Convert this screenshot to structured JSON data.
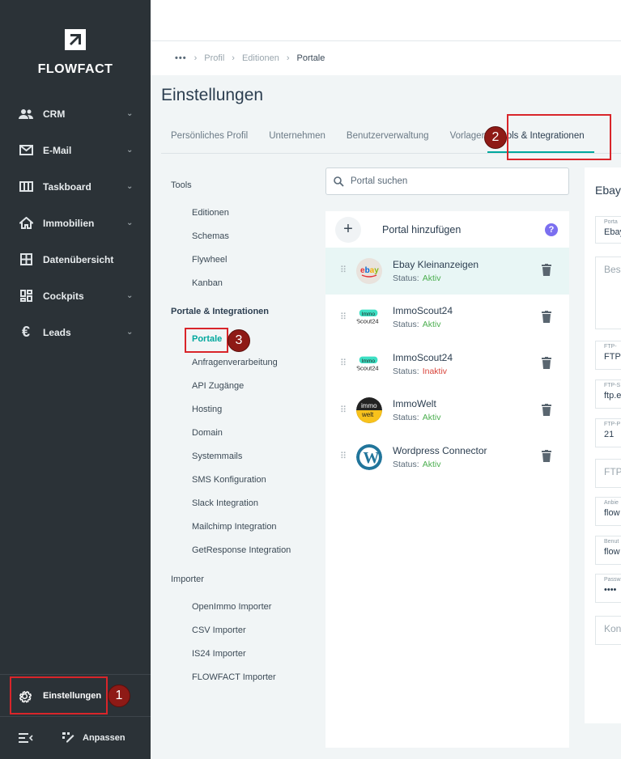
{
  "app": {
    "brand": "FLOWFACT"
  },
  "sidebar": {
    "items": [
      {
        "label": "CRM",
        "icon": "people-icon"
      },
      {
        "label": "E-Mail",
        "icon": "mail-icon"
      },
      {
        "label": "Taskboard",
        "icon": "board-icon"
      },
      {
        "label": "Immobilien",
        "icon": "home-icon"
      },
      {
        "label": "Datenübersicht",
        "icon": "grid-icon"
      },
      {
        "label": "Cockpits",
        "icon": "dashboard-icon"
      },
      {
        "label": "Leads",
        "icon": "euro-icon"
      }
    ],
    "settings_label": "Einstellungen",
    "customize_label": "Anpassen"
  },
  "breadcrumb": {
    "more": "•••",
    "items": [
      "Profil",
      "Editionen"
    ],
    "current": "Portale"
  },
  "page": {
    "title": "Einstellungen"
  },
  "tabs": [
    "Persönliches Profil",
    "Unternehmen",
    "Benutzerverwaltung",
    "Vorlagen",
    "Tools & Integrationen"
  ],
  "menu": {
    "tools_head": "Tools",
    "tools": [
      "Editionen",
      "Schemas",
      "Flywheel",
      "Kanban"
    ],
    "portals_head": "Portale & Integrationen",
    "portals": [
      "Portale",
      "Anfragenverarbeitung",
      "API Zugänge",
      "Hosting",
      "Domain",
      "Systemmails",
      "SMS Konfiguration",
      "Slack Integration",
      "Mailchimp Integration",
      "GetResponse Integration"
    ],
    "importer_head": "Importer",
    "importers": [
      "OpenImmo Importer",
      "CSV Importer",
      "IS24 Importer",
      "FLOWFACT Importer"
    ]
  },
  "portal_list": {
    "search_placeholder": "Portal suchen",
    "add_label": "Portal hinzufügen",
    "status_label": "Status:",
    "items": [
      {
        "name": "Ebay Kleinanzeigen",
        "status": "Aktiv",
        "logo": "ebay"
      },
      {
        "name": "ImmoScout24",
        "status": "Aktiv",
        "logo": "immoscout"
      },
      {
        "name": "ImmoScout24",
        "status": "Inaktiv",
        "logo": "immoscout"
      },
      {
        "name": "ImmoWelt",
        "status": "Aktiv",
        "logo": "immowelt"
      },
      {
        "name": "Wordpress Connector",
        "status": "Aktiv",
        "logo": "wordpress"
      }
    ]
  },
  "detail": {
    "title": "Ebay",
    "portal_label": "Porta",
    "portal_value": "Ebay",
    "desc_placeholder": "Bes",
    "ftp1_label": "FTP-",
    "ftp1_value": "FTP",
    "ftp2_label": "FTP-S",
    "ftp2_value": "ftp.e",
    "ftp3_label": "FTP-P",
    "ftp3_value": "21",
    "ftp4_placeholder": "FTP",
    "anb_label": "Anbie",
    "anb_value": "flow",
    "ben_label": "Benut",
    "ben_value": "flow",
    "pw_label": "Passw",
    "pw_value": "••••",
    "kon_placeholder": "Kon"
  },
  "annotations": [
    "1",
    "2",
    "3"
  ],
  "colors": {
    "accent": "#00a89d",
    "sidebar": "#2b3237",
    "highlight": "#d9252a"
  }
}
